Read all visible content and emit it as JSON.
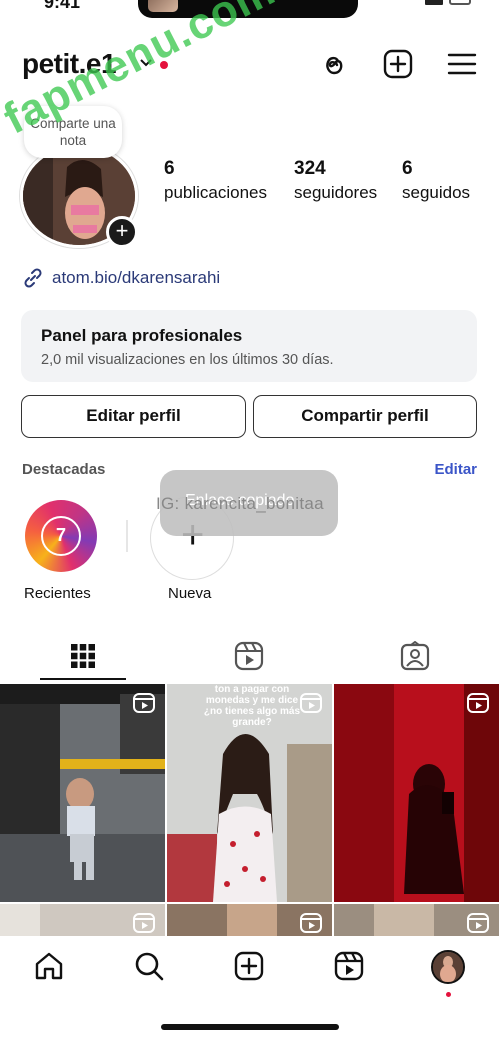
{
  "status_bar": {
    "time": "9:41"
  },
  "header": {
    "username": "petit.e1"
  },
  "watermark": "fapmenu.com",
  "profile": {
    "note": "Comparte una nota",
    "stats": [
      {
        "num": "6",
        "label": "publicaciones"
      },
      {
        "num": "324",
        "label": "seguidores"
      },
      {
        "num": "6",
        "label": "seguidos"
      }
    ],
    "link": "atom.bio/dkarensarahi"
  },
  "pro_panel": {
    "title": "Panel para profesionales",
    "subtitle": "2,0 mil visualizaciones en los últimos 30 días."
  },
  "buttons": {
    "edit": "Editar perfil",
    "share": "Compartir perfil"
  },
  "highlights": {
    "label": "Destacadas",
    "edit": "Editar",
    "items": [
      {
        "caption": "Recientes",
        "badge": "7"
      },
      {
        "caption": "Nueva"
      }
    ]
  },
  "toast": {
    "text": "Enlace copiado"
  },
  "overlay_text": "IG: karencita_bonitaa",
  "grid": {
    "posts": [
      {
        "type": "reel",
        "caption": ""
      },
      {
        "type": "reel",
        "caption": "ton a pagar con monedas y me dice ¿no tienes algo más grande?"
      },
      {
        "type": "reel",
        "caption": ""
      },
      {
        "type": "reel",
        "caption": ""
      },
      {
        "type": "reel",
        "caption": ""
      },
      {
        "type": "reel",
        "caption": ""
      }
    ]
  },
  "icons": {
    "threads": "threads-icon",
    "create": "plus-square-icon",
    "menu": "hamburger-menu-icon",
    "link": "link-icon",
    "grid_tab": "grid-icon",
    "reels_tab": "reels-icon",
    "tagged_tab": "tagged-person-icon",
    "nav": [
      "home-icon",
      "search-icon",
      "create-icon",
      "reels-icon",
      "profile-avatar"
    ]
  },
  "colors": {
    "accent_blue": "#3b55c8",
    "link_blue": "#2b3a78",
    "notification_red": "#e4123d",
    "watermark_green": "#3cc850"
  }
}
